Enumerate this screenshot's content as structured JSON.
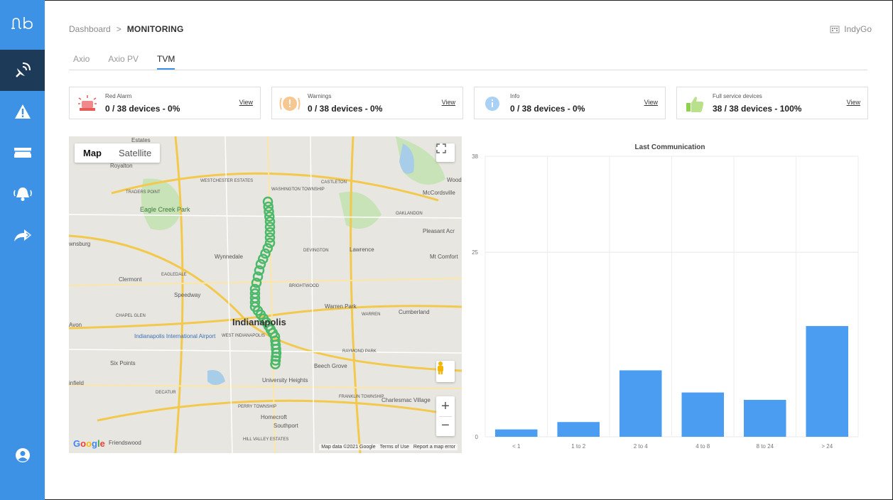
{
  "sidebar": {
    "items": [
      {
        "icon": "satellite-dish-icon",
        "active": true
      },
      {
        "icon": "warning-icon",
        "active": false
      },
      {
        "icon": "ticket-icon",
        "active": false
      },
      {
        "icon": "alarm-bell-icon",
        "active": false
      },
      {
        "icon": "share-forward-icon",
        "active": false
      },
      {
        "icon": "user-icon",
        "active": false
      }
    ]
  },
  "breadcrumb": {
    "root": "Dashboard",
    "separator": ">",
    "current": "MONITORING"
  },
  "org": {
    "name": "IndyGo"
  },
  "tabs": [
    "Axio",
    "Axio PV",
    "TVM"
  ],
  "cards": [
    {
      "title": "Red Alarm",
      "value": "0 / 38 devices - 0%",
      "link": "View",
      "icon": "red-alarm-icon"
    },
    {
      "title": "Warnings",
      "value": "0 / 38 devices - 0%",
      "link": "View",
      "icon": "warning-icon"
    },
    {
      "title": "Info",
      "value": "0 / 38 devices - 0%",
      "link": "View",
      "icon": "info-icon"
    },
    {
      "title": "Full service devices",
      "value": "38 / 38 devices - 100%",
      "link": "View",
      "icon": "thumbs-up-icon"
    }
  ],
  "map": {
    "toggle": {
      "map": "Map",
      "satellite": "Satellite"
    },
    "labels": {
      "estates": "Estates",
      "royalton": "Royalton",
      "traders_point": "TRADERS POINT",
      "westchester": "WESTCHESTER ESTATES",
      "washington": "WASHINGTON TOWNSHIP",
      "castleton": "CASTLETON",
      "wood": "Wood",
      "mccordsville": "McCordsville",
      "eagle_creek": "Eagle Creek Park",
      "oaklandon": "OAKLANDON",
      "pleasant": "Pleasant Acr",
      "brownsburg": "wnsburg",
      "wynnedale": "Wynnedale",
      "devington": "DEVINGTON",
      "lawrence": "Lawrence",
      "mt_comfort": "Mt Comfort",
      "clermont": "Clermont",
      "eagledale": "EAGLEDALE",
      "speedway": "Speedway",
      "brightwood": "BRIGHTWOOD",
      "chapel_glen": "CHAPEL GLEN",
      "indianapolis": "Indianapolis",
      "warren_park": "Warren Park",
      "warren": "WARREN",
      "cumberland": "Cumberland",
      "airport": "Indianapolis International Airport",
      "west_indianapolis": "WEST INDIANAPOLIS",
      "raymond_park": "RAYMOND PARK",
      "six_points": "Six Points",
      "beech_grove": "Beech Grove",
      "university_heights": "University Heights",
      "decatur": "DECATUR",
      "perry": "PERRY TOWNSHIP",
      "franklin": "FRANKLIN TOWNSHIP",
      "charlesmac": "Charlesmac Village",
      "homecroft": "Homecroft",
      "southport": "Southport",
      "hill_valley": "HILL VALLEY ESTATES",
      "friendswood": "Friendswood",
      "avon": "Avon",
      "plainfield": "infield"
    },
    "google": "Google",
    "attribution": [
      "Map data ©2021 Google",
      "Terms of Use",
      "Report a map error"
    ]
  },
  "chart_data": {
    "type": "bar",
    "title": "Last Communication",
    "categories": [
      "< 1",
      "1 to 2",
      "2 to 4",
      "4 to 8",
      "8 to 24",
      "> 24"
    ],
    "values": [
      1,
      2,
      9,
      6,
      5,
      15
    ],
    "yticks": [
      0,
      25,
      38
    ],
    "ylim": [
      0,
      38
    ],
    "color": "#4a9df0",
    "grid": true
  }
}
